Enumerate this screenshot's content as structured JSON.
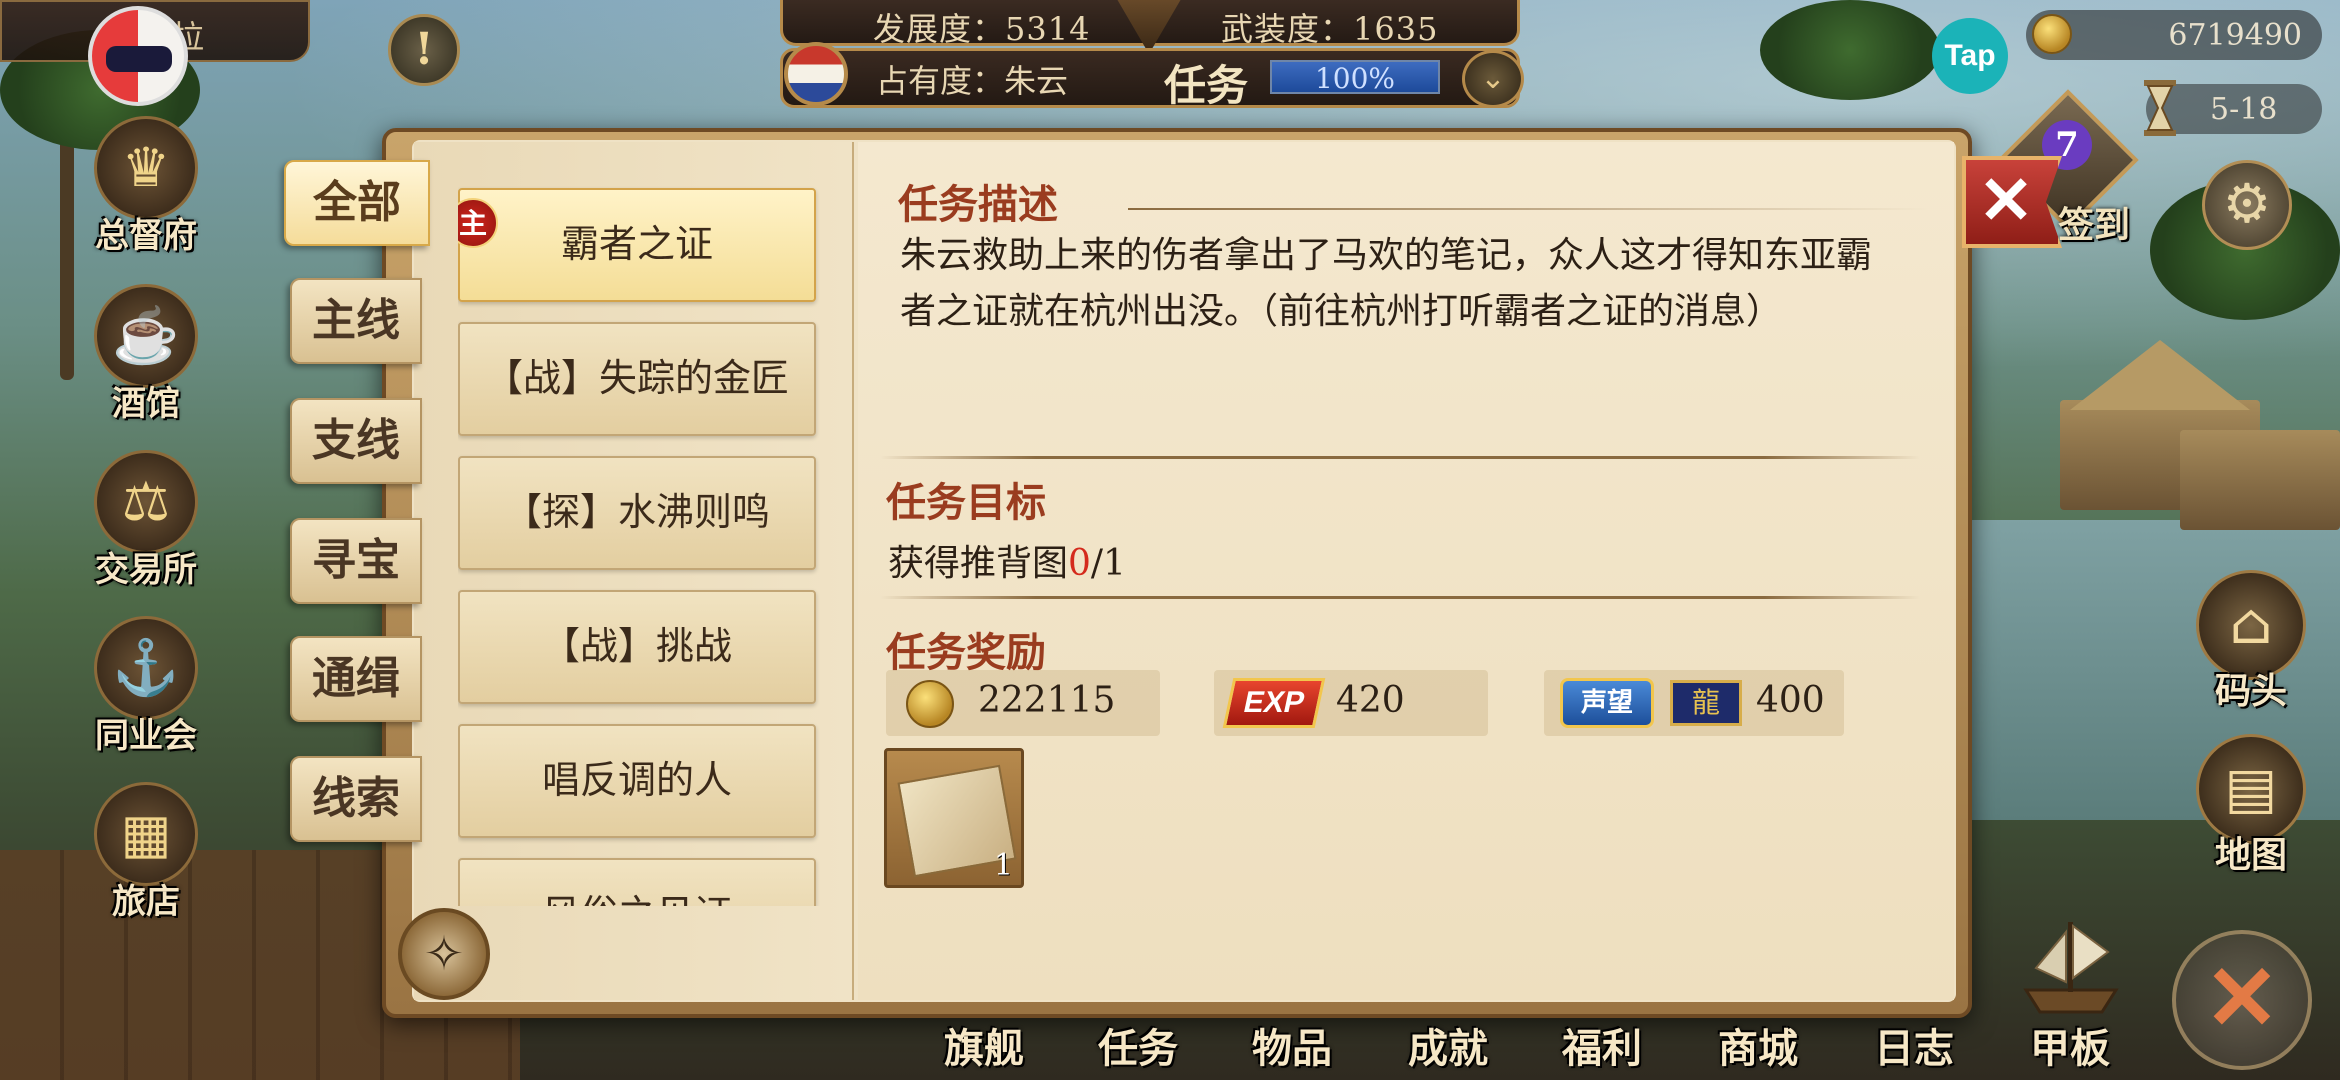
{
  "hud": {
    "development_label": "发展度：5314",
    "armament_label": "武装度：1635",
    "ownership_label": "占有度：朱云",
    "task_label": "任务",
    "progress_text": "100%",
    "progress": 1.0
  },
  "player": {
    "name_fragment": "拉"
  },
  "topright": {
    "tap_logo": "Tap",
    "gold_amount": "6719490",
    "date": "5-18",
    "signin_count": "7",
    "signin_label": "签到"
  },
  "left_nav": [
    {
      "label": "总督府",
      "icon": "crown-icon"
    },
    {
      "label": "酒馆",
      "icon": "beer-mug-icon"
    },
    {
      "label": "交易所",
      "icon": "scales-icon"
    },
    {
      "label": "同业会",
      "icon": "anchor-shield-icon"
    },
    {
      "label": "旅店",
      "icon": "inn-bed-icon"
    }
  ],
  "right_nav": [
    {
      "label": "码头",
      "icon": "dock-icon"
    },
    {
      "label": "地图",
      "icon": "map-icon"
    }
  ],
  "bottom_nav": [
    "旗舰",
    "任务",
    "物品",
    "成就",
    "福利",
    "商城",
    "日志",
    "甲板"
  ],
  "categories": [
    "全部",
    "主线",
    "支线",
    "寻宝",
    "通缉",
    "线索"
  ],
  "active_category": "全部",
  "quests": [
    {
      "title": "霸者之证",
      "badge": "主",
      "active": true
    },
    {
      "title": "【战】失踪的金匠"
    },
    {
      "title": "【探】水沸则鸣"
    },
    {
      "title": "【战】挑战"
    },
    {
      "title": "唱反调的人"
    },
    {
      "title": "风俗之见证"
    }
  ],
  "detail": {
    "desc_title": "任务描述",
    "desc_text": "朱云救助上来的伤者拿出了马欢的笔记，众人这才得知东亚霸者之证就在杭州出没。（前往杭州打听霸者之证的消息）",
    "goal_title": "任务目标",
    "goal_prefix": "获得推背图",
    "goal_current": "0",
    "goal_total": "/1",
    "reward_title": "任务奖励",
    "rewards": {
      "gold": "222115",
      "exp_label": "EXP",
      "exp": "420",
      "fame_label": "声望",
      "fame": "400"
    },
    "item_count": "1"
  },
  "colors": {
    "accent_red": "#9a3c1f",
    "goal_red": "#d42a1c",
    "parchment": "#efe2c5"
  }
}
